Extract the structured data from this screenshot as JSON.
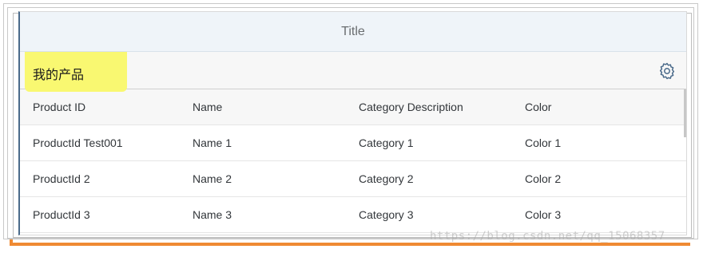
{
  "window": {
    "title": "Title"
  },
  "toolbar": {
    "title": "我的产品",
    "settings_icon": "gear-icon"
  },
  "table": {
    "columns": [
      "Product ID",
      "Name",
      "Category Description",
      "Color"
    ],
    "rows": [
      [
        "ProductId Test001",
        "Name 1",
        "Category 1",
        "Color 1"
      ],
      [
        "ProductId 2",
        "Name 2",
        "Category 2",
        "Color 2"
      ],
      [
        "ProductId 3",
        "Name 3",
        "Category 3",
        "Color 3"
      ]
    ]
  },
  "watermark": "https://blog.csdn.net/qq_15068357",
  "colors": {
    "highlight": "#f9f871",
    "title_bar": "#eff4f9",
    "accent_orange": "#ef8a33",
    "accent_olive": "#8aa36a",
    "icon": "#4a6a8a"
  }
}
